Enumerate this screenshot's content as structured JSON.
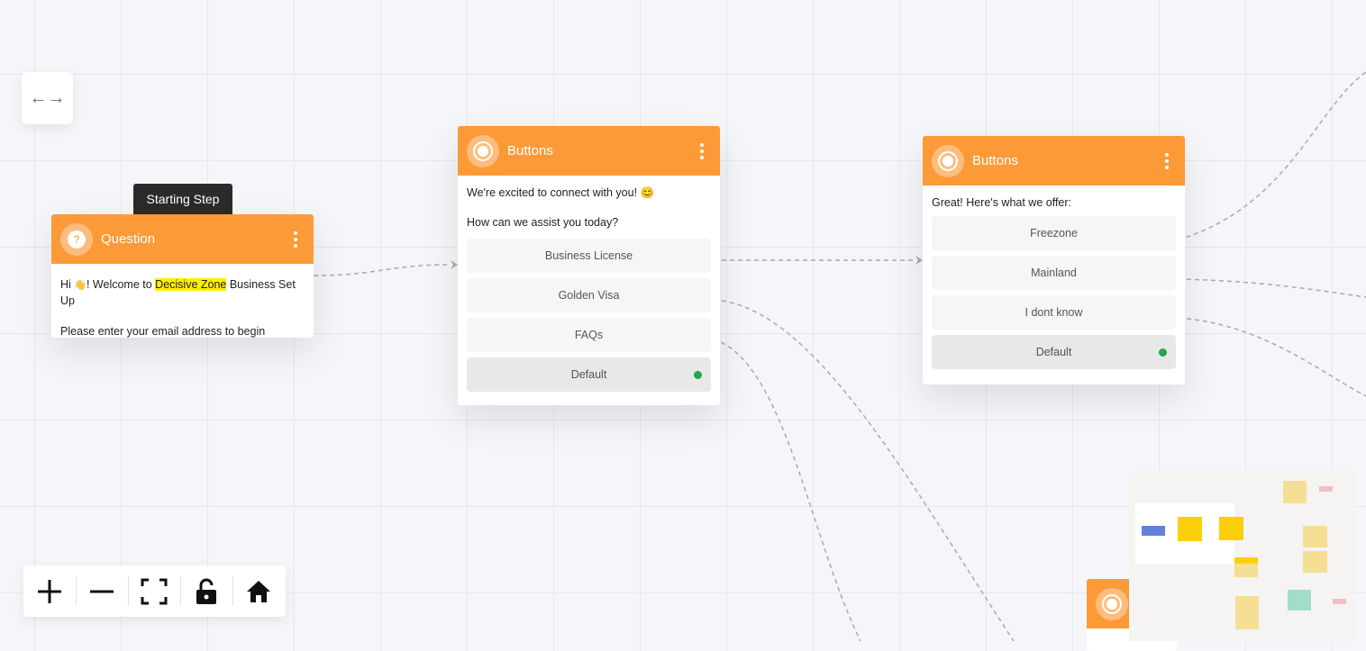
{
  "toggle": {
    "icon": "left-right-arrows-icon",
    "glyph": "←→"
  },
  "start_tooltip": "Starting Step",
  "nodes": {
    "question": {
      "title": "Question",
      "icon": "question-icon",
      "msg_pre": "Hi ",
      "msg_emoji": "👋",
      "msg_mid": "! Welcome to ",
      "msg_highlight": "Decisive Zone",
      "msg_post": " Business Set Up",
      "msg2": "Please enter your email address to begin"
    },
    "buttons1": {
      "title": "Buttons",
      "icon": "radio-icon",
      "line1": "We're excited to connect with you! 😊",
      "line2": "How can we assist you today?",
      "options": [
        "Business License",
        "Golden Visa",
        "FAQs",
        "Default"
      ]
    },
    "buttons2": {
      "title": "Buttons",
      "icon": "radio-icon",
      "line1": "Great! Here's what we offer:",
      "options": [
        "Freezone",
        "Mainland",
        "I dont know",
        "Default"
      ]
    }
  },
  "toolbar": [
    "zoom-in-icon",
    "zoom-out-icon",
    "fit-view-icon",
    "unlock-icon",
    "home-icon"
  ],
  "colors": {
    "accent": "#fd9a38",
    "default_dot": "#22a64a",
    "highlight": "#ffef00"
  }
}
